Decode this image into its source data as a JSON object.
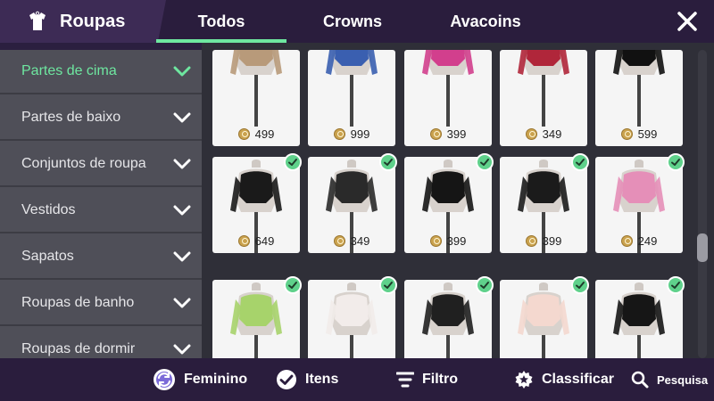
{
  "header": {
    "title": "Roupas",
    "brand_icon": "shirt-icon",
    "tabs": [
      {
        "label": "Todos",
        "active": true
      },
      {
        "label": "Crowns",
        "active": false
      },
      {
        "label": "Avacoins",
        "active": false
      }
    ],
    "close_icon": "close-icon"
  },
  "sidebar": {
    "items": [
      {
        "label": "Partes de cima",
        "active": true
      },
      {
        "label": "Partes de baixo",
        "active": false
      },
      {
        "label": "Conjuntos de roupa",
        "active": false
      },
      {
        "label": "Vestidos",
        "active": false
      },
      {
        "label": "Sapatos",
        "active": false
      },
      {
        "label": "Roupas de banho",
        "active": false
      },
      {
        "label": "Roupas de dormir",
        "active": false
      }
    ]
  },
  "grid": {
    "rows": [
      [
        {
          "price": "499",
          "owned": false
        },
        {
          "price": "999",
          "owned": false
        },
        {
          "price": "399",
          "owned": false
        },
        {
          "price": "349",
          "owned": false
        },
        {
          "price": "599",
          "owned": false
        }
      ],
      [
        {
          "price": "649",
          "owned": true
        },
        {
          "price": "349",
          "owned": true
        },
        {
          "price": "399",
          "owned": true
        },
        {
          "price": "399",
          "owned": true
        },
        {
          "price": "249",
          "owned": true
        }
      ],
      [
        {
          "price": "",
          "owned": true
        },
        {
          "price": "",
          "owned": true
        },
        {
          "price": "",
          "owned": true
        },
        {
          "price": "",
          "owned": true
        },
        {
          "price": "",
          "owned": true
        }
      ]
    ]
  },
  "bottom_bar": {
    "gender_label": "Feminino",
    "items_label": "Itens",
    "filter_label": "Filtro",
    "sort_label": "Classificar",
    "search_label": "Pesquisa"
  },
  "colors": {
    "accent": "#6ee7a0",
    "topbar": "#2a1d3d",
    "sidebar": "#4f4f58",
    "check": "#5fd18b"
  }
}
